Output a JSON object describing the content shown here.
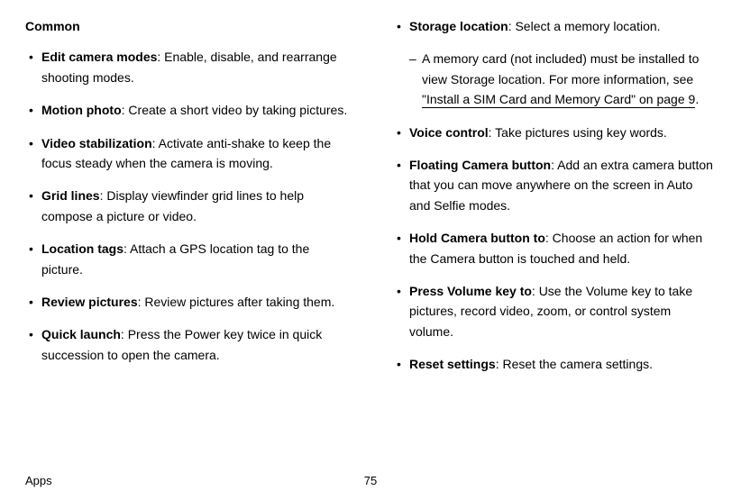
{
  "section_header": "Common",
  "left_items": [
    {
      "term": "Edit camera modes",
      "desc": ": Enable, disable, and rearrange shooting modes."
    },
    {
      "term": "Motion photo",
      "desc": ": Create a short video by taking pictures."
    },
    {
      "term": "Video stabilization",
      "desc": ": Activate anti-shake to keep the focus steady when the camera is moving."
    },
    {
      "term": "Grid lines",
      "desc": ": Display viewfinder grid lines to help compose a picture or video."
    },
    {
      "term": "Location tags",
      "desc": ": Attach a GPS location tag to the picture."
    },
    {
      "term": "Review pictures",
      "desc": ": Review pictures after taking them."
    },
    {
      "term": "Quick launch",
      "desc": ": Press the Power key twice in quick succession to open the camera."
    }
  ],
  "right_items": [
    {
      "term": "Storage location",
      "desc": ": Select a memory location."
    }
  ],
  "right_sub": {
    "prefix": "A memory card (not included) must be installed to view Storage location. For more information, see ",
    "link": "\"Install a SIM Card and Memory Card\" on page 9",
    "suffix": "."
  },
  "right_items2": [
    {
      "term": "Voice control",
      "desc": ": Take pictures using key words."
    },
    {
      "term": "Floating Camera button",
      "desc": ": Add an extra camera button that you can move anywhere on the screen in Auto and Selfie modes."
    },
    {
      "term": "Hold Camera button to",
      "desc": ": Choose an action for when the Camera button is touched and held."
    },
    {
      "term": "Press Volume key to",
      "desc": ": Use the Volume key to take pictures, record video, zoom, or control system volume."
    },
    {
      "term": "Reset settings",
      "desc": ": Reset the camera settings."
    }
  ],
  "footer": {
    "section": "Apps",
    "page": "75"
  }
}
